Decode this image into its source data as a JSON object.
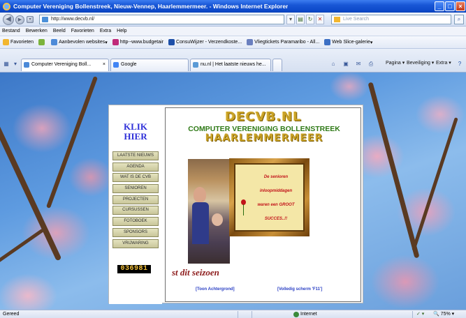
{
  "window": {
    "title": "Computer Vereniging Bollenstreek, Nieuw-Vennep, Haarlemmermeer. - Windows Internet Explorer"
  },
  "address_bar": {
    "url": "http://www.decvb.nl/",
    "search_placeholder": "Live Search"
  },
  "menu": [
    "Bestand",
    "Bewerken",
    "Beeld",
    "Favorieten",
    "Extra",
    "Help"
  ],
  "favorites_bar": {
    "favorites_label": "Favorieten",
    "items": [
      "Aanbevolen websites",
      "http--www.budgetair",
      "ConsuWijzer - Verzendkoste...",
      "Vliegtickets Paramaribo - All...",
      "Web Slice-galerie"
    ]
  },
  "tabs": [
    {
      "label": "Computer Vereniging Boll...",
      "active": true
    },
    {
      "label": "Google",
      "active": false
    },
    {
      "label": "nu.nl | Het laatste nieuws he...",
      "active": false
    }
  ],
  "command_bar": {
    "page": "Pagina",
    "safety": "Beveiliging",
    "tools": "Extra"
  },
  "site": {
    "klik": "KLIK",
    "hier": "HIER",
    "nav": [
      "LAATSTE NIEUWS",
      "AGENDA",
      "WAT IS DE CVB",
      "SENIOREN",
      "PROJECTEN",
      "CURSUSSEN",
      "FOTOBOEK",
      "SPONSORS",
      "VRIJWARING"
    ],
    "counter": "036981",
    "logo": "DECVB.NL",
    "subtitle1": "COMPUTER VERENIGING BOLLENSTREEK",
    "subtitle2": "HAARLEMMERMEER",
    "frame_lines": [
      "De senioren",
      "inloopmiddagen",
      "waren een GROOT",
      "SUCCES..!!"
    ],
    "seizoen": "st dit seizoen",
    "link_bg": "[Toon Achtergrond]",
    "link_full": "[Volledig scherm 'F11']"
  },
  "status": {
    "left": "Gereed",
    "zone": "Internet",
    "zoom": "75%"
  },
  "colors": {
    "title_bar": "#0b47c8",
    "nav_button": "#c9c69a",
    "klik_text": "#2e2fd8",
    "logo_gold": "#c9a227",
    "subtitle_green": "#2f7a17",
    "seizoen_text": "#8c1b1b"
  }
}
